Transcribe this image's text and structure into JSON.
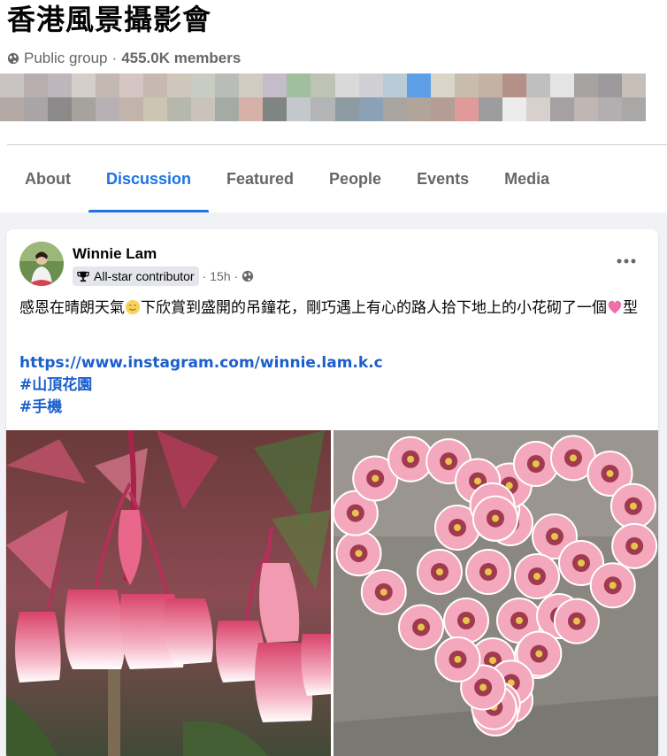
{
  "group": {
    "title": "香港風景攝影會",
    "privacy": "Public group",
    "separator": "·",
    "members": "455.0K members"
  },
  "tabs": [
    {
      "label": "About"
    },
    {
      "label": "Discussion"
    },
    {
      "label": "Featured"
    },
    {
      "label": "People"
    },
    {
      "label": "Events"
    },
    {
      "label": "Media"
    }
  ],
  "post": {
    "author": "Winnie Lam",
    "badge": "All-star contributor",
    "time": "15h",
    "dot": "·",
    "text_part1": "感恩在晴朗天氣",
    "text_part2": "下欣賞到盛開的吊鐘花，剛巧遇上有心的路人拾下地上的小花砌了一個",
    "text_part3": "型",
    "link": "https://www.instagram.com/winnie.lam.k.c",
    "hashtag1": "#山頂花園",
    "hashtag2": "#手機"
  },
  "icons": {
    "privacy": "globe-icon",
    "badge": "trophy-icon",
    "audience": "globe-icon",
    "menu": "more-icon",
    "emoji1": "smiling-face-emoji",
    "emoji2": "pink-heart-emoji"
  },
  "colors": {
    "accent": "#1b74e4",
    "link": "#1b5fcc",
    "secondary_text": "#65676b",
    "background": "#f0f2f5"
  }
}
